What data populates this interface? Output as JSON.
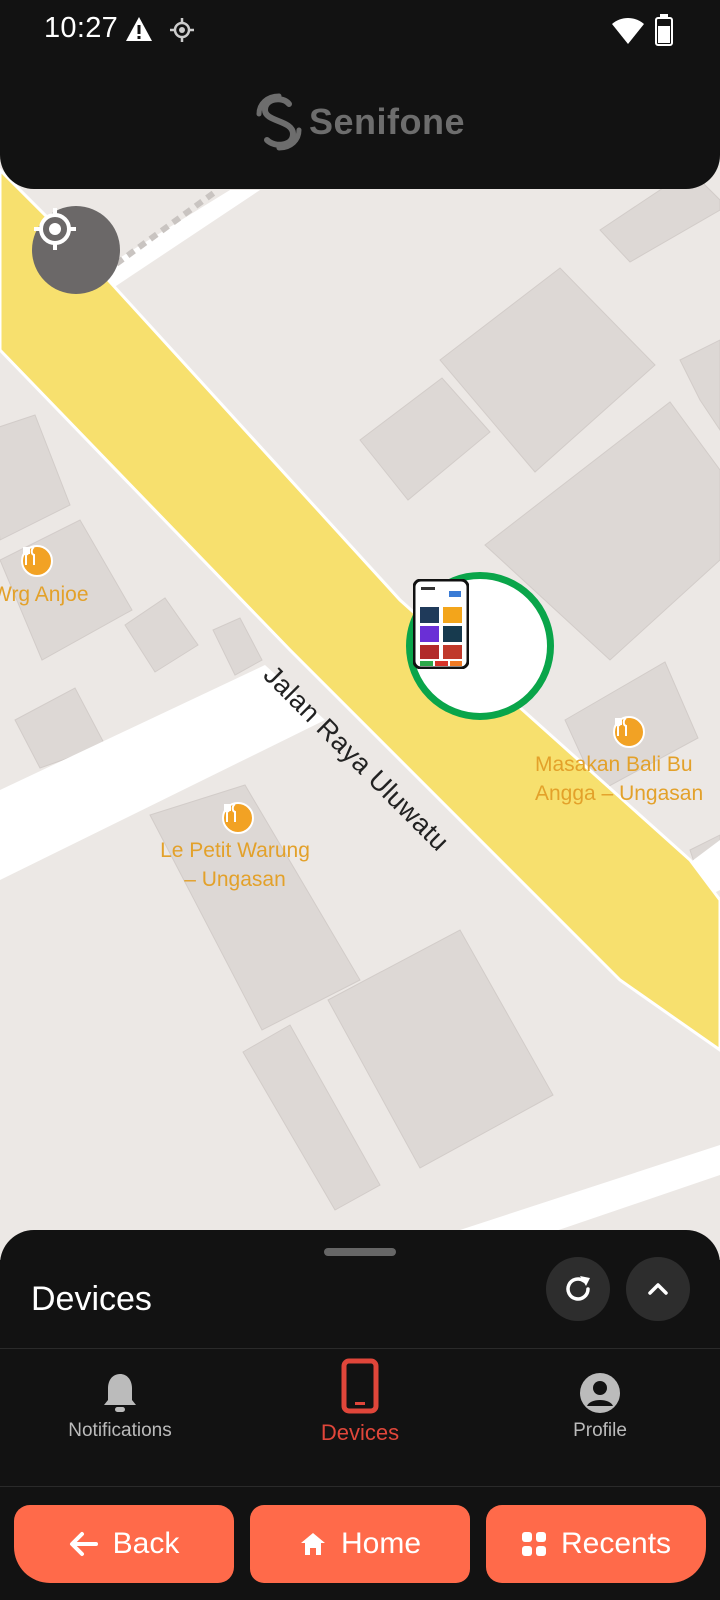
{
  "status": {
    "time": "10:27"
  },
  "header": {
    "brand": "Senifone"
  },
  "map": {
    "road_name": "Jalan Raya Uluwatu",
    "places": [
      {
        "name": "Wrg Anjoe"
      },
      {
        "name": "Le Petit Warung – Ungasan"
      },
      {
        "name": "Masakan Bali Bu Angga – Ungasan"
      }
    ],
    "place_lines": {
      "anjoe": "Wrg Anjoe",
      "petit_1": "Le Petit Warung",
      "petit_2": "– Ungasan",
      "bali_1": "Masakan Bali Bu",
      "bali_2": "Angga – Ungasan"
    },
    "marker_color": "#0aa54a"
  },
  "sheet": {
    "title": "Devices"
  },
  "nav": {
    "items": [
      {
        "label": "Notifications",
        "icon": "bell-icon"
      },
      {
        "label": "Devices",
        "icon": "phone-icon",
        "active": true
      },
      {
        "label": "Profile",
        "icon": "account-icon"
      }
    ],
    "active_color": "#e0463a"
  },
  "bottom": {
    "back": "Back",
    "home": "Home",
    "recents": "Recents",
    "color": "#ff6a4a"
  }
}
